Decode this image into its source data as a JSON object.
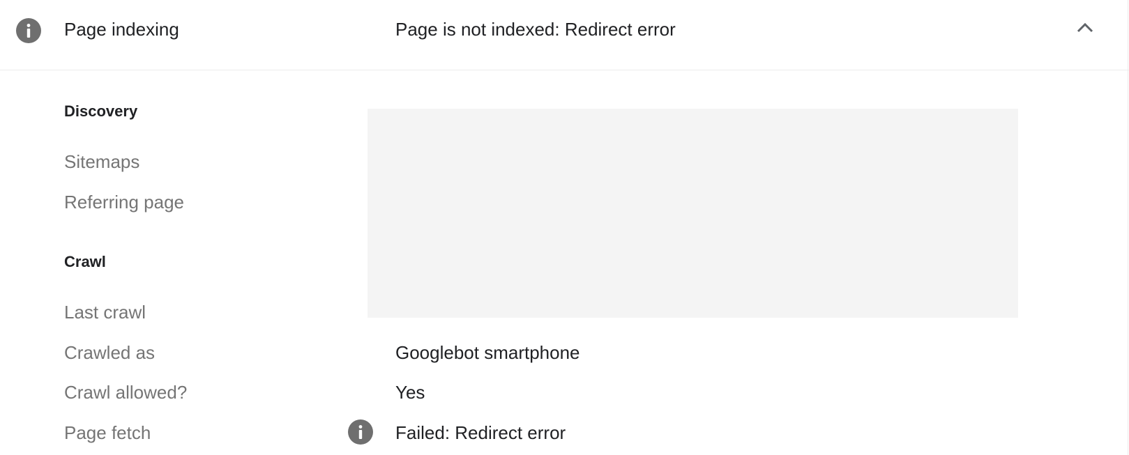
{
  "header": {
    "label": "Page indexing",
    "status": "Page is not indexed: Redirect error"
  },
  "discovery": {
    "title": "Discovery",
    "rows": [
      {
        "label": "Sitemaps",
        "value": ""
      },
      {
        "label": "Referring page",
        "value": ""
      }
    ]
  },
  "crawl": {
    "title": "Crawl",
    "rows": [
      {
        "label": "Last crawl",
        "value": ""
      },
      {
        "label": "Crawled as",
        "value": "Googlebot smartphone"
      },
      {
        "label": "Crawl allowed?",
        "value": "Yes"
      },
      {
        "label": "Page fetch",
        "value": "Failed: Redirect error"
      }
    ]
  },
  "icons": {
    "header_icon": "info-icon",
    "collapse_icon": "chevron-up-icon",
    "page_fetch_icon": "info-icon"
  },
  "colors": {
    "icon_gray": "#6f6f6f",
    "label_gray": "#757575",
    "text": "#202124",
    "redaction": "#f4f4f4"
  }
}
